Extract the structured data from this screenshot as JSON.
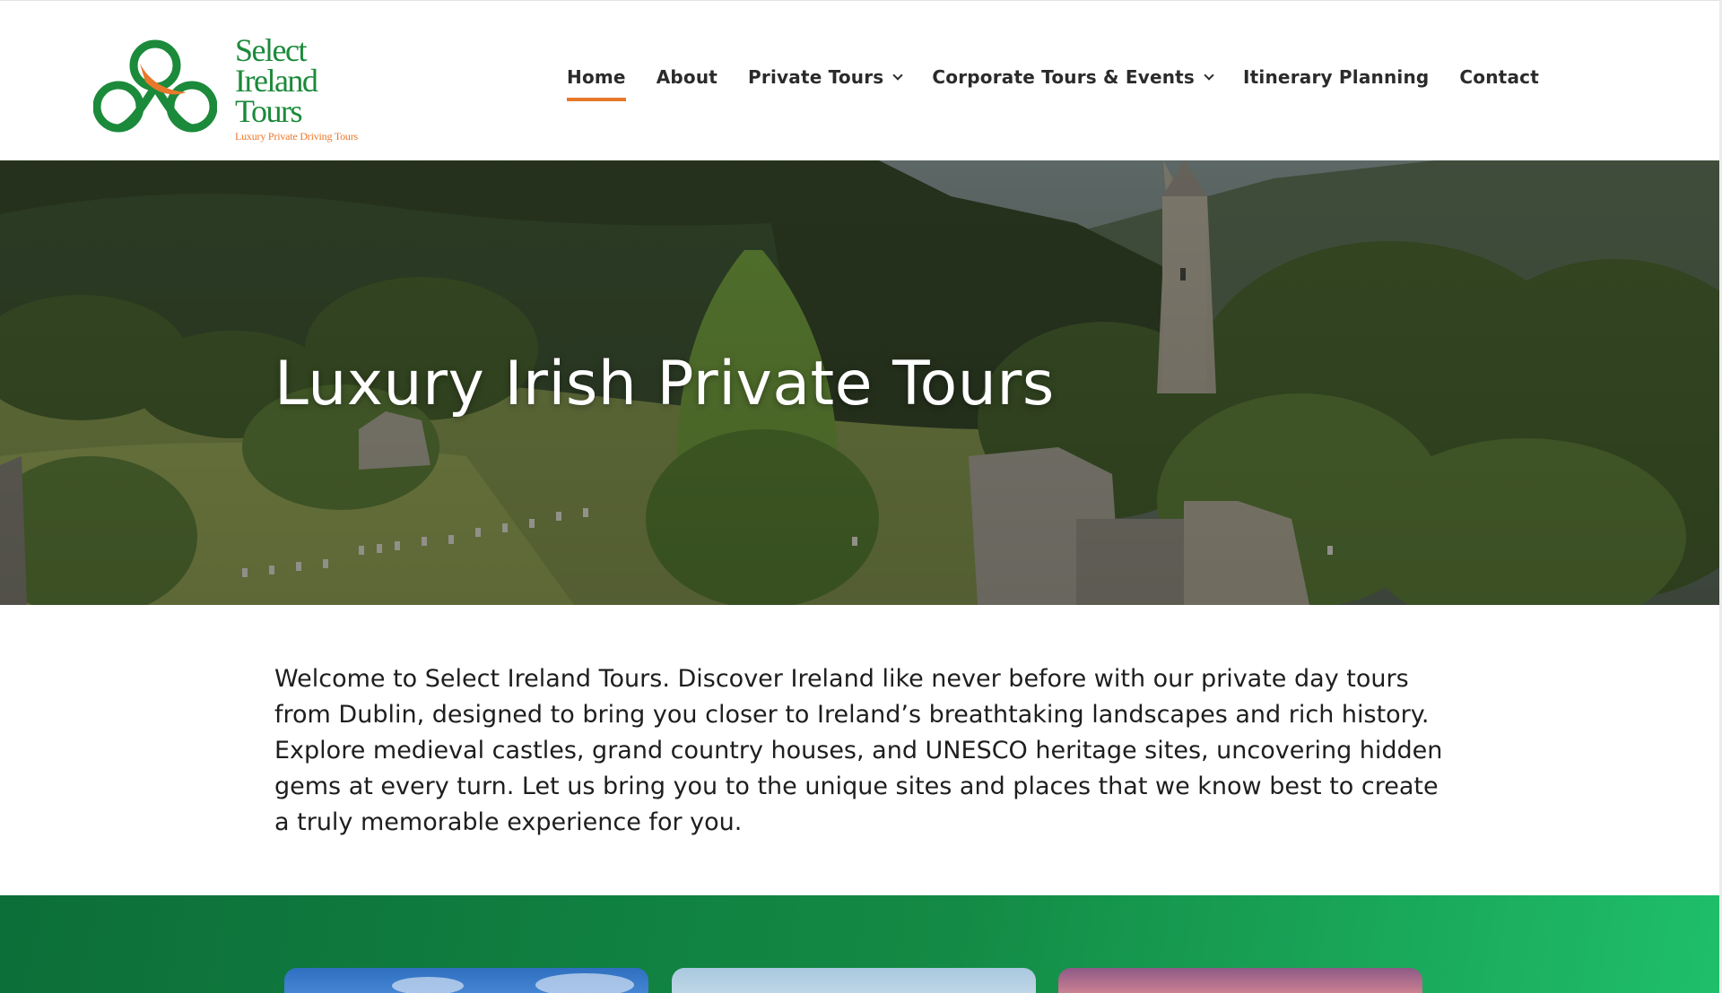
{
  "brand": {
    "words": [
      "Select",
      "Ireland",
      "Tours"
    ],
    "tagline": "Luxury Private Driving Tours",
    "colors": {
      "green": "#1b8a3a",
      "orange": "#e8782b"
    }
  },
  "nav": {
    "items": [
      {
        "label": "Home",
        "active": true,
        "dropdown": false
      },
      {
        "label": "About",
        "active": false,
        "dropdown": false
      },
      {
        "label": "Private Tours",
        "active": false,
        "dropdown": true
      },
      {
        "label": "Corporate Tours & Events",
        "active": false,
        "dropdown": true
      },
      {
        "label": "Itinerary Planning",
        "active": false,
        "dropdown": false
      },
      {
        "label": "Contact",
        "active": false,
        "dropdown": false
      }
    ],
    "dropdown_icon": "chevron-down-icon",
    "active_underline_color": "#e8782b"
  },
  "hero": {
    "title": "Luxury Irish Private Tours",
    "image": "Glendalough round tower and monastic ruins in wooded valley"
  },
  "intro": {
    "text": "Welcome to Select Ireland Tours. Discover Ireland like never before with our private day tours from Dublin, designed to bring you closer to Ireland’s breathtaking landscapes and rich history. Explore medieval castles, grand country houses, and UNESCO heritage sites, uncovering hidden gems at every turn. Let us bring you to the unique sites and places that we know best to create a truly memorable experience for you."
  },
  "band": {
    "colors": [
      "#0c6e38",
      "#1fbf6b"
    ],
    "cards": [
      "blue-sky-card",
      "pale-sky-card",
      "sunset-sky-card"
    ]
  }
}
